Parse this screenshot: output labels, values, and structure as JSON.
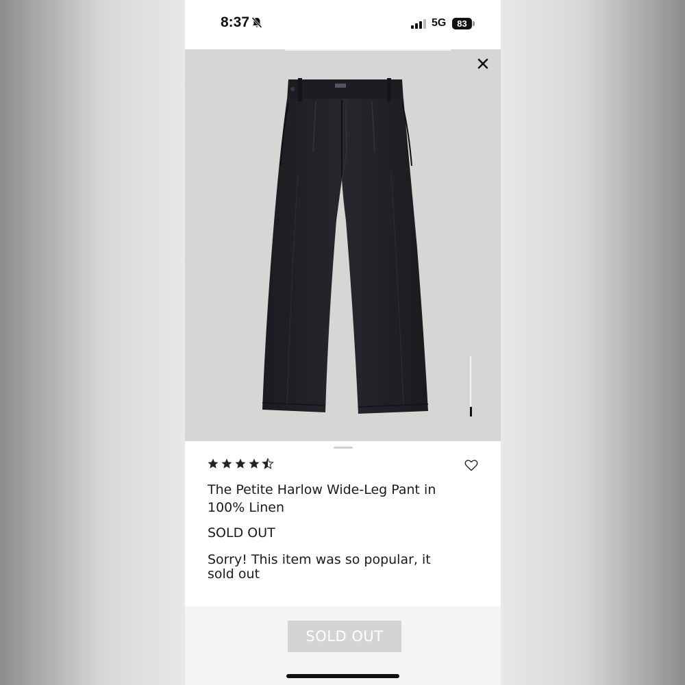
{
  "status_bar": {
    "time": "8:37",
    "network": "5G",
    "battery": "83",
    "icons": [
      "bell-slash-icon",
      "signal-icon",
      "battery-icon"
    ]
  },
  "product": {
    "rating": 4.5,
    "rating_max": 5,
    "title": "The Petite Harlow Wide-Leg Pant in 100% Linen",
    "status": "SOLD OUT",
    "message": "Sorry! This item was so popular, it sold out",
    "image_icon": "wide-leg-pant-image"
  },
  "actions": {
    "button_label": "SOLD OUT",
    "close_icon": "close-icon",
    "favorite_icon": "heart-icon"
  },
  "colors": {
    "image_background": "#d6d6d5",
    "button_background": "#d4d4d4",
    "text": "#1a1a1a"
  }
}
